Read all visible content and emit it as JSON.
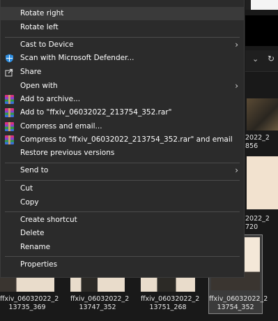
{
  "menu": {
    "items": [
      {
        "id": "rotate-right",
        "label": "Rotate right"
      },
      {
        "id": "rotate-left",
        "label": "Rotate left"
      },
      {
        "id": "cast",
        "label": "Cast to Device"
      },
      {
        "id": "defender",
        "label": "Scan with Microsoft Defender..."
      },
      {
        "id": "share",
        "label": "Share"
      },
      {
        "id": "open-with",
        "label": "Open with"
      },
      {
        "id": "add-archive",
        "label": "Add to archive..."
      },
      {
        "id": "add-rar",
        "label": "Add to \"ffxiv_06032022_213754_352.rar\""
      },
      {
        "id": "compress-email",
        "label": "Compress and email..."
      },
      {
        "id": "compress-rar-email",
        "label": "Compress to \"ffxiv_06032022_213754_352.rar\" and email"
      },
      {
        "id": "restore",
        "label": "Restore previous versions"
      },
      {
        "id": "send-to",
        "label": "Send to"
      },
      {
        "id": "cut",
        "label": "Cut"
      },
      {
        "id": "copy",
        "label": "Copy"
      },
      {
        "id": "shortcut",
        "label": "Create shortcut"
      },
      {
        "id": "delete",
        "label": "Delete"
      },
      {
        "id": "rename",
        "label": "Rename"
      },
      {
        "id": "properties",
        "label": "Properties"
      }
    ]
  },
  "files": [
    {
      "line1": "ffxiv_06032022_2",
      "line2": "13735_369"
    },
    {
      "line1": "ffxiv_06032022_2",
      "line2": "13747_352"
    },
    {
      "line1": "ffxiv_06032022_2",
      "line2": "13751_268"
    },
    {
      "line1": "ffxiv_06032022_2",
      "line2": "13754_352"
    }
  ],
  "side_files": [
    {
      "line1": "2022_2",
      "line2": "856"
    },
    {
      "line1": "2022_2",
      "line2": "720"
    }
  ],
  "toolbar": {
    "chevron": "⌄",
    "refresh": "↻"
  }
}
